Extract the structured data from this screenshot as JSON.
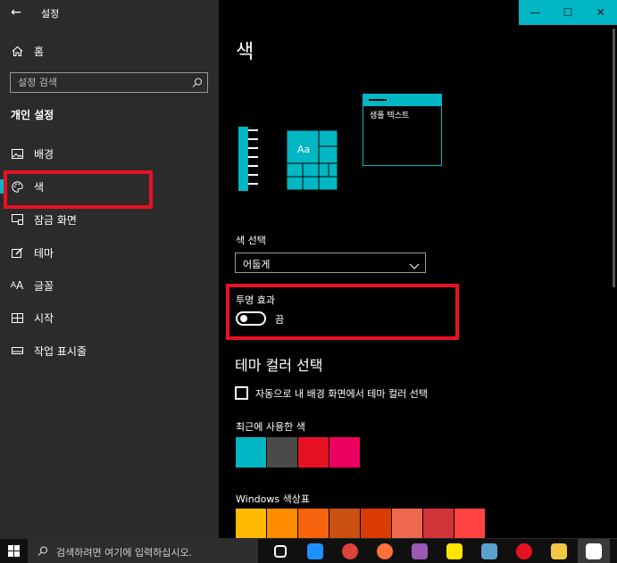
{
  "window": {
    "title": "설정",
    "caption": {
      "minimize": "—",
      "maximize": "☐",
      "close": "✕"
    },
    "accent_color": "#00b7c3"
  },
  "sidebar": {
    "home_label": "홈",
    "search_placeholder": "설정 검색",
    "section_heading": "개인 설정",
    "items": [
      {
        "label": "배경",
        "icon": "picture-icon"
      },
      {
        "label": "색",
        "icon": "palette-icon",
        "active": true
      },
      {
        "label": "잠금 화면",
        "icon": "lock-screen-icon"
      },
      {
        "label": "테마",
        "icon": "theme-brush-icon"
      },
      {
        "label": "글꼴",
        "icon": "font-icon"
      },
      {
        "label": "시작",
        "icon": "start-grid-icon"
      },
      {
        "label": "작업 표시줄",
        "icon": "taskbar-icon"
      }
    ]
  },
  "main": {
    "page_title": "색",
    "preview": {
      "sample_text": "샘플 텍스트",
      "tile_label": "Aa"
    },
    "color_choice": {
      "label": "색 선택",
      "selected": "어둡게"
    },
    "transparency": {
      "label": "투명 효과",
      "state": "끔",
      "on": false
    },
    "theme_color": {
      "heading": "테마 컬러 선택",
      "auto_checkbox_label": "자동으로 내 배경 화면에서 테마 컬러 선택",
      "auto_checked": false,
      "recent_label": "최근에 사용한 색",
      "recent_colors": [
        "#00b7c3",
        "#4c4a48",
        "#e81123",
        "#ea005e"
      ],
      "palette_label": "Windows 색상표",
      "palette_colors": [
        "#ffb900",
        "#ff8c00",
        "#f7630c",
        "#ca5010",
        "#da3b01",
        "#ef6950",
        "#d13438",
        "#ff4343"
      ]
    }
  },
  "taskbar": {
    "search_placeholder": "검색하려면 여기에 입력하십시오.",
    "apps": [
      {
        "name": "task-view-icon",
        "color": "#ffffff"
      },
      {
        "name": "edge-icon",
        "color": "#1e90ff"
      },
      {
        "name": "chrome-icon",
        "color": "#db4437"
      },
      {
        "name": "firefox-icon",
        "color": "#ff7139"
      },
      {
        "name": "paint-icon",
        "color": "#9b59b6"
      },
      {
        "name": "kakaotalk-icon",
        "color": "#fee500"
      },
      {
        "name": "app-icon",
        "color": "#5aa0d0"
      },
      {
        "name": "recorder-icon",
        "color": "#e81123"
      },
      {
        "name": "file-explorer-icon",
        "color": "#f2c744"
      },
      {
        "name": "settings-gear-icon",
        "color": "#ffffff"
      }
    ]
  }
}
